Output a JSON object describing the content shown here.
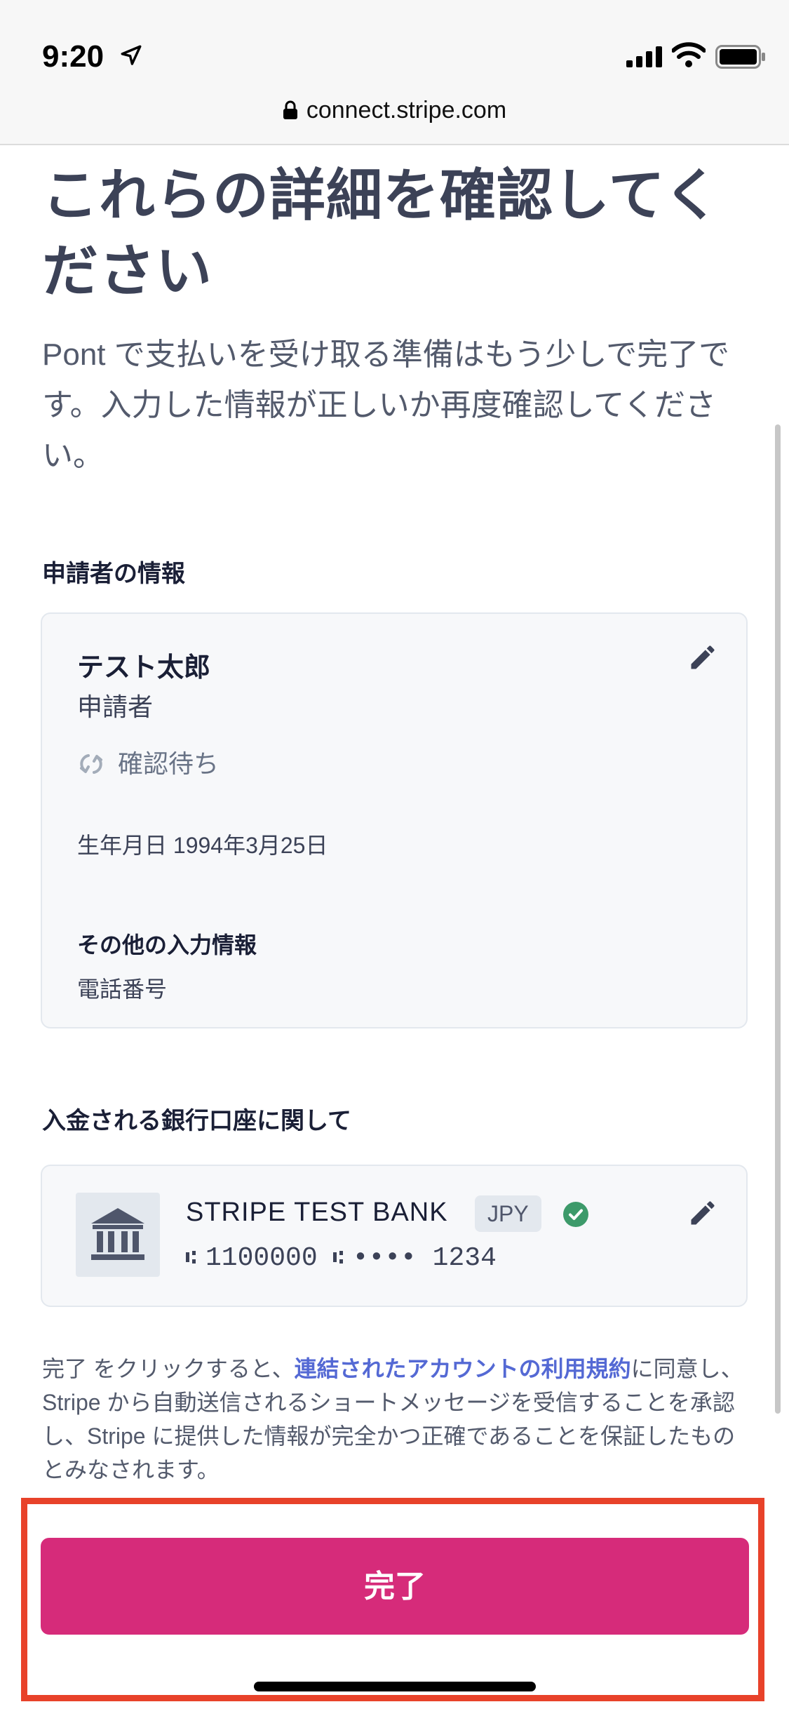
{
  "status_bar": {
    "time": "9:20",
    "url": "connect.stripe.com"
  },
  "page": {
    "title": "これらの詳細を確認してください",
    "subtitle": "Pont で支払いを受け取る準備はもう少しで完了です。入力した情報が正しいか再度確認してください。"
  },
  "applicant_section": {
    "heading": "申請者の情報",
    "name": "テスト太郎",
    "role": "申請者",
    "status": "確認待ち",
    "dob": "生年月日 1994年3月25日",
    "other_heading": "その他の入力情報",
    "other_item": "電話番号"
  },
  "bank_section": {
    "heading": "入金される銀行口座に関して",
    "bank_name": "STRIPE TEST BANK",
    "currency": "JPY",
    "routing_number": "1100000",
    "account_masked": "•••• 1234"
  },
  "legal": {
    "prefix": "完了 をクリックすると、",
    "link": "連結されたアカウントの利用規約",
    "suffix": "に同意し、Stripe から自動送信されるショートメッセージを受信することを承認し、Stripe に提供した情報が完全かつ正確であることを保証したものとみなされます。"
  },
  "actions": {
    "done_label": "完了"
  },
  "colors": {
    "accent": "#d62b7a",
    "link": "#5469d4",
    "highlight": "#e8422a",
    "verified": "#3d9a6a"
  }
}
